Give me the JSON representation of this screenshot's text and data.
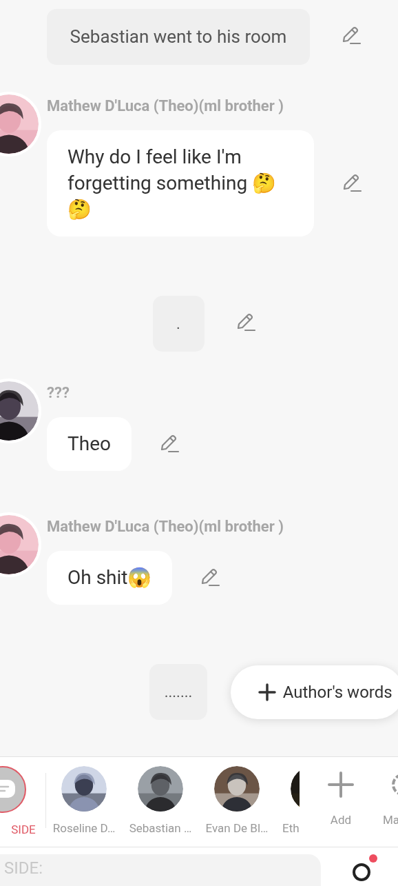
{
  "messages": [
    {
      "kind": "narration",
      "text": "Sebastian went to his room"
    },
    {
      "kind": "character",
      "name": "Mathew D'Luca (Theo)(ml brother )",
      "text": "Why do I feel like I'm forgetting something 🤔🤔"
    },
    {
      "kind": "narration",
      "text": "."
    },
    {
      "kind": "character",
      "name": "???",
      "text": "Theo"
    },
    {
      "kind": "character",
      "name": "Mathew D'Luca (Theo)(ml brother )",
      "text": "Oh shit😱"
    },
    {
      "kind": "narration",
      "text": "......."
    }
  ],
  "author_button": {
    "label": "Author's words"
  },
  "cast": [
    {
      "kind": "side",
      "label": "SIDE",
      "selected": true
    },
    {
      "kind": "character",
      "label": "Roseline D…",
      "selected": false
    },
    {
      "kind": "character",
      "label": "Sebastian …",
      "selected": false
    },
    {
      "kind": "character",
      "label": "Evan De Bl…",
      "selected": false
    },
    {
      "kind": "character",
      "label": "Eth",
      "selected": false
    },
    {
      "kind": "add",
      "label": "Add"
    },
    {
      "kind": "manage",
      "label": "Ma"
    }
  ],
  "input": {
    "placeholder": "SIDE:"
  }
}
